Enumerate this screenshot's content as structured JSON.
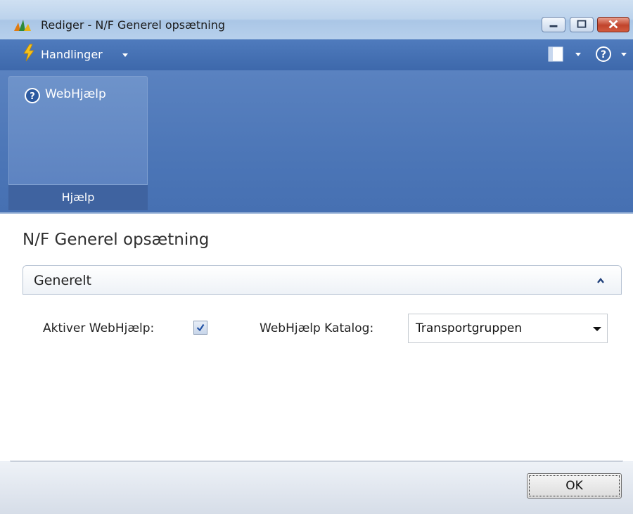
{
  "window": {
    "title": "Rediger - N/F Generel opsætning"
  },
  "action_bar": {
    "menu_label": "Handlinger",
    "layout_icon": "layout-icon",
    "help_icon": "help-icon"
  },
  "ribbon": {
    "groups": [
      {
        "label": "Hjælp",
        "buttons": [
          {
            "label": "WebHjælp",
            "icon": "help-icon"
          }
        ]
      }
    ]
  },
  "page": {
    "title": "N/F Generel opsætning",
    "fasttab": {
      "title": "Generelt",
      "fields": [
        {
          "label": "Aktiver WebHjælp:",
          "type": "checkbox",
          "checked": true
        },
        {
          "label": "WebHjælp Katalog:",
          "type": "select",
          "value": "Transportgruppen"
        }
      ]
    }
  },
  "footer": {
    "ok_label": "OK"
  },
  "colors": {
    "ribbon_blue": "#4c76b7",
    "menubar_blue": "#3d68ab",
    "close_red": "#c1442c"
  }
}
